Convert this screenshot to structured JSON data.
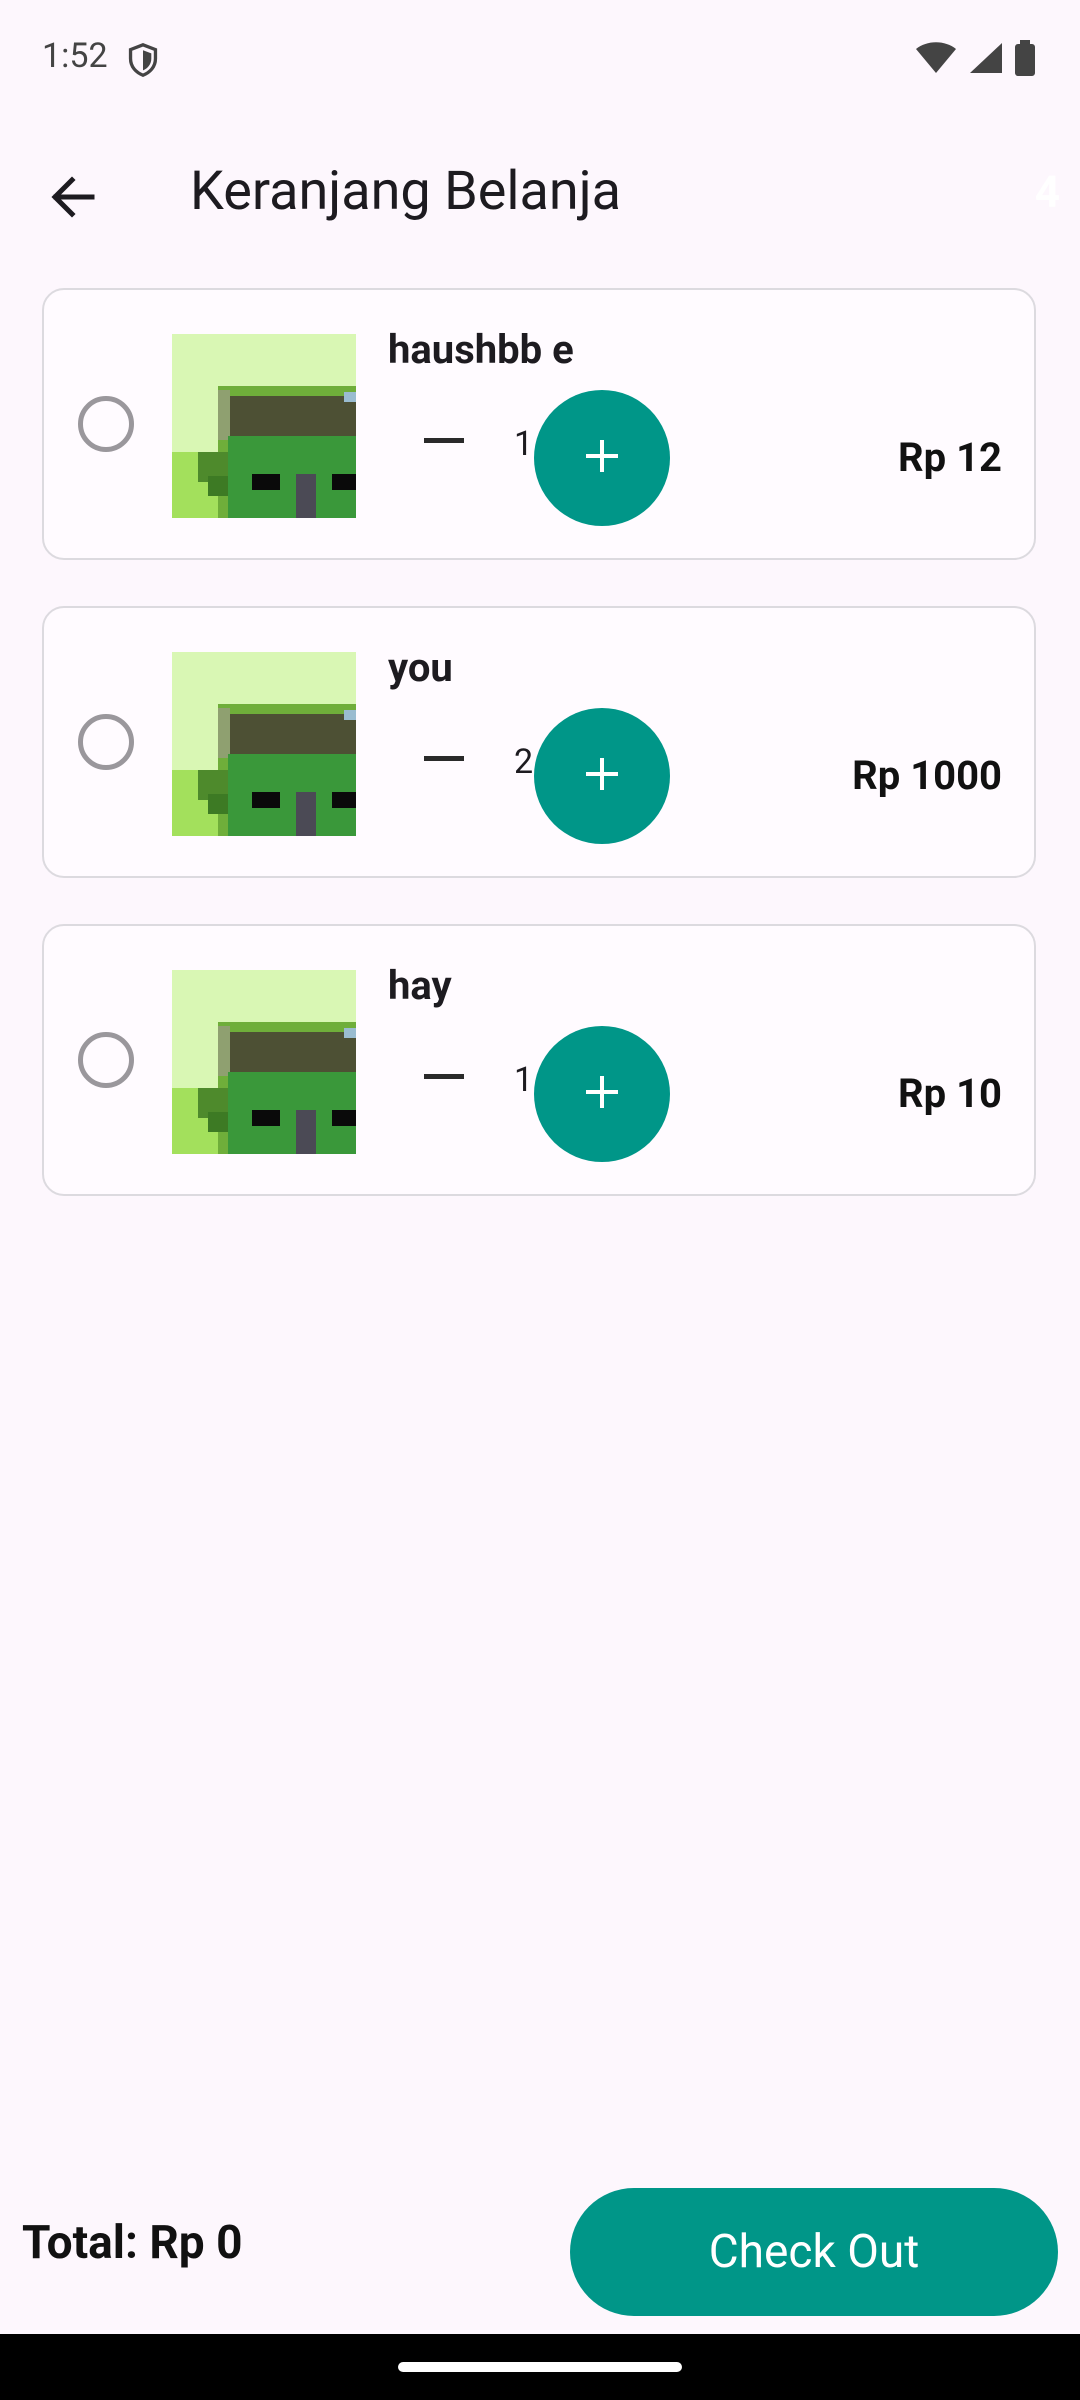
{
  "status_bar": {
    "time": "1:52"
  },
  "app_bar": {
    "title": "Keranjang Belanja",
    "cart_count": "4"
  },
  "cart_items": [
    {
      "name": "haushbb e",
      "quantity": "1",
      "price": "Rp 12"
    },
    {
      "name": "you",
      "quantity": "2",
      "price": "Rp 1000"
    },
    {
      "name": "hay",
      "quantity": "1",
      "price": "Rp 10"
    }
  ],
  "footer": {
    "total": "Total: Rp 0",
    "checkout_label": "Check Out"
  },
  "colors": {
    "accent": "#009688",
    "background": "#fdf7fd"
  }
}
